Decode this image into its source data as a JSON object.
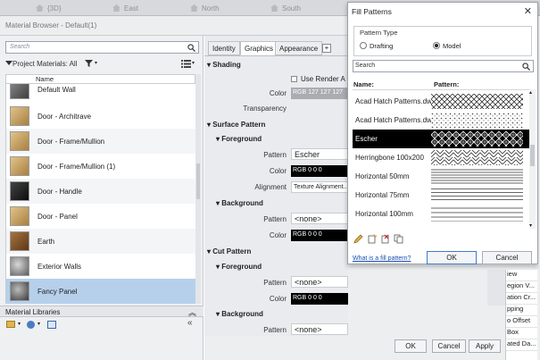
{
  "top_tabs": [
    "{3D}",
    "East",
    "North",
    "South"
  ],
  "window": {
    "title": "Material Browser - Default(1)"
  },
  "left": {
    "search_placeholder": "Search",
    "project_label": "Project Materials: All",
    "list_header": "Name",
    "materials": [
      {
        "name": "Default Wall",
        "color": "#6b6b6b"
      },
      {
        "name": "Door - Architrave",
        "color": "#c8a46a"
      },
      {
        "name": "Door - Frame/Mullion",
        "color": "#c8a46a"
      },
      {
        "name": "Door - Frame/Mullion (1)",
        "color": "#c8a46a"
      },
      {
        "name": "Door - Handle",
        "color": "#2a2a2a"
      },
      {
        "name": "Door - Panel",
        "color": "#c8a46a"
      },
      {
        "name": "Earth",
        "color": "#8a5a2a"
      },
      {
        "name": "Exterior Walls",
        "color": "#9a9a9a"
      },
      {
        "name": "Fancy Panel",
        "color": "#7d7d7d"
      }
    ],
    "libraries_label": "Material Libraries"
  },
  "mid": {
    "tabs": [
      "Identity",
      "Graphics",
      "Appearance"
    ],
    "shading": "Shading",
    "use_render": "Use Render A",
    "color_label": "Color",
    "shading_color": "RGB 127 127 127",
    "transparency_label": "Transparency",
    "surface_pattern": "Surface Pattern",
    "foreground": "Foreground",
    "background": "Background",
    "pattern_label": "Pattern",
    "alignment_label": "Alignment",
    "sp_fg_pattern": "Escher",
    "sp_fg_color": "RGB 0 0 0",
    "sp_fg_alignment": "Texture Alignment...",
    "sp_bg_pattern": "<none>",
    "sp_bg_color": "RGB 0 0 0",
    "cut_pattern": "Cut Pattern",
    "cp_fg_pattern": "<none>",
    "cp_fg_color": "RGB 0 0 0",
    "cp_bg_pattern": "<none>"
  },
  "right_list": [
    "iew",
    "egion V...",
    "ation Cr...",
    "pping",
    "o Offset",
    "Box",
    "ated Da..."
  ],
  "bottom_buttons": {
    "ok": "OK",
    "cancel": "Cancel",
    "apply": "Apply"
  },
  "dialog": {
    "title": "Fill Patterns",
    "pattern_type_label": "Pattern Type",
    "drafting_label": "Drafting",
    "model_label": "Model",
    "search_value": "Search",
    "col_name": "Name:",
    "col_pattern": "Pattern:",
    "patterns": [
      {
        "name": "Acad Hatch Patterns.dw",
        "kind": "check"
      },
      {
        "name": "Acad Hatch Patterns.dw",
        "kind": "dots"
      },
      {
        "name": "Escher",
        "kind": "escher",
        "selected": true
      },
      {
        "name": "Herringbone 100x200",
        "kind": "herring"
      },
      {
        "name": "Horizontal  50mm",
        "kind": "h50"
      },
      {
        "name": "Horizontal  75mm",
        "kind": "h75"
      },
      {
        "name": "Horizontal 100mm",
        "kind": "h100"
      }
    ],
    "link": "What is a fill pattern?",
    "ok": "OK",
    "cancel": "Cancel"
  }
}
